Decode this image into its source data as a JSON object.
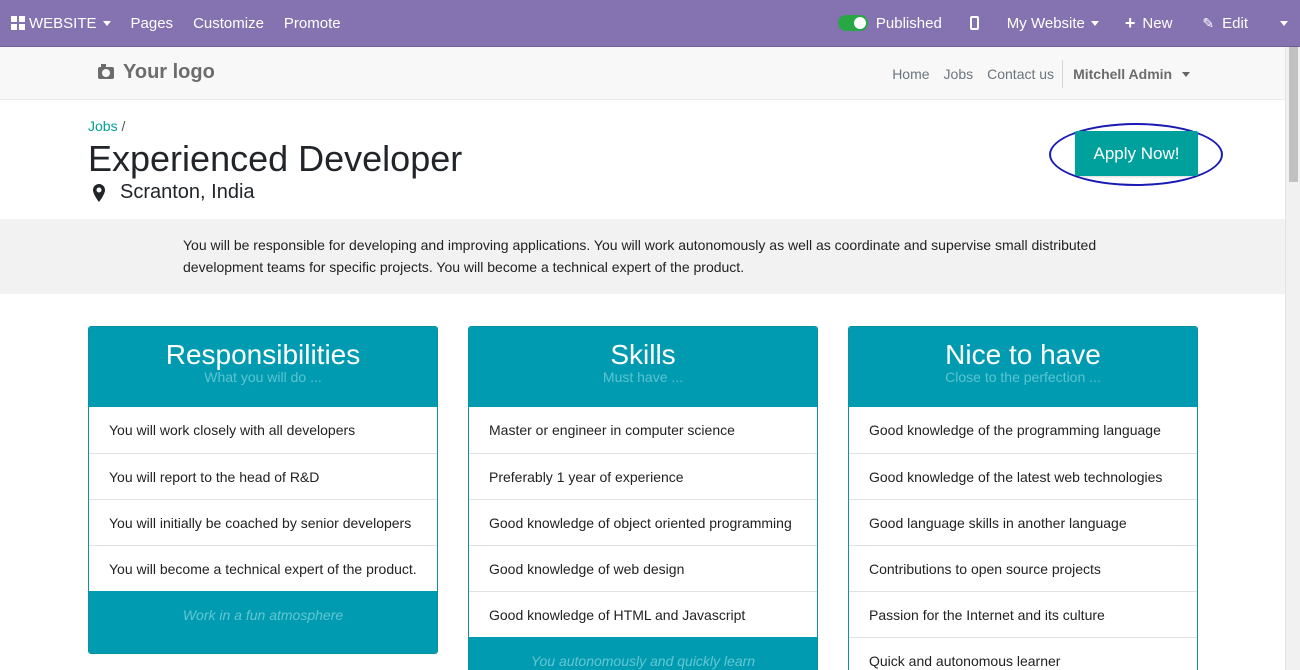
{
  "topbar": {
    "app_menu_label": "WEBSITE",
    "menu": [
      "Pages",
      "Customize",
      "Promote"
    ],
    "published_label": "Published",
    "site_label": "My Website",
    "new_label": "New",
    "edit_label": "Edit"
  },
  "header": {
    "logo_text": "Your logo",
    "nav": [
      "Home",
      "Jobs",
      "Contact us"
    ],
    "user": "Mitchell Admin"
  },
  "job": {
    "breadcrumb_link": "Jobs",
    "breadcrumb_sep": "/",
    "title": "Experienced Developer",
    "location": "Scranton, India",
    "apply_label": "Apply Now!",
    "description": "You will be responsible for developing and improving applications. You will work autonomously as well as coordinate and supervise small distributed development teams for specific projects. You will become a technical expert of the product."
  },
  "cards": [
    {
      "title": "Responsibilities",
      "subtitle": "What you will do ...",
      "items": [
        "You will work closely with all developers",
        "You will report to the head of R&D",
        "You will initially be coached by senior developers",
        "You will become a technical expert of the product."
      ],
      "footer": "Work in a fun atmosphere"
    },
    {
      "title": "Skills",
      "subtitle": "Must have ...",
      "items": [
        "Master or engineer in computer science",
        "Preferably 1 year of experience",
        "Good knowledge of object oriented programming",
        "Good knowledge of web design",
        "Good knowledge of HTML and Javascript"
      ],
      "footer": "You autonomously and quickly learn"
    },
    {
      "title": "Nice to have",
      "subtitle": "Close to the perfection ...",
      "items": [
        "Good knowledge of the programming language",
        "Good knowledge of the latest web technologies",
        "Good language skills in another language",
        "Contributions to open source projects",
        "Passion for the Internet and its culture",
        "Quick and autonomous learner"
      ],
      "footer": ""
    }
  ],
  "colors": {
    "topbar": "#8572b0",
    "accent": "#00a09d",
    "card_header": "#009bb0"
  }
}
